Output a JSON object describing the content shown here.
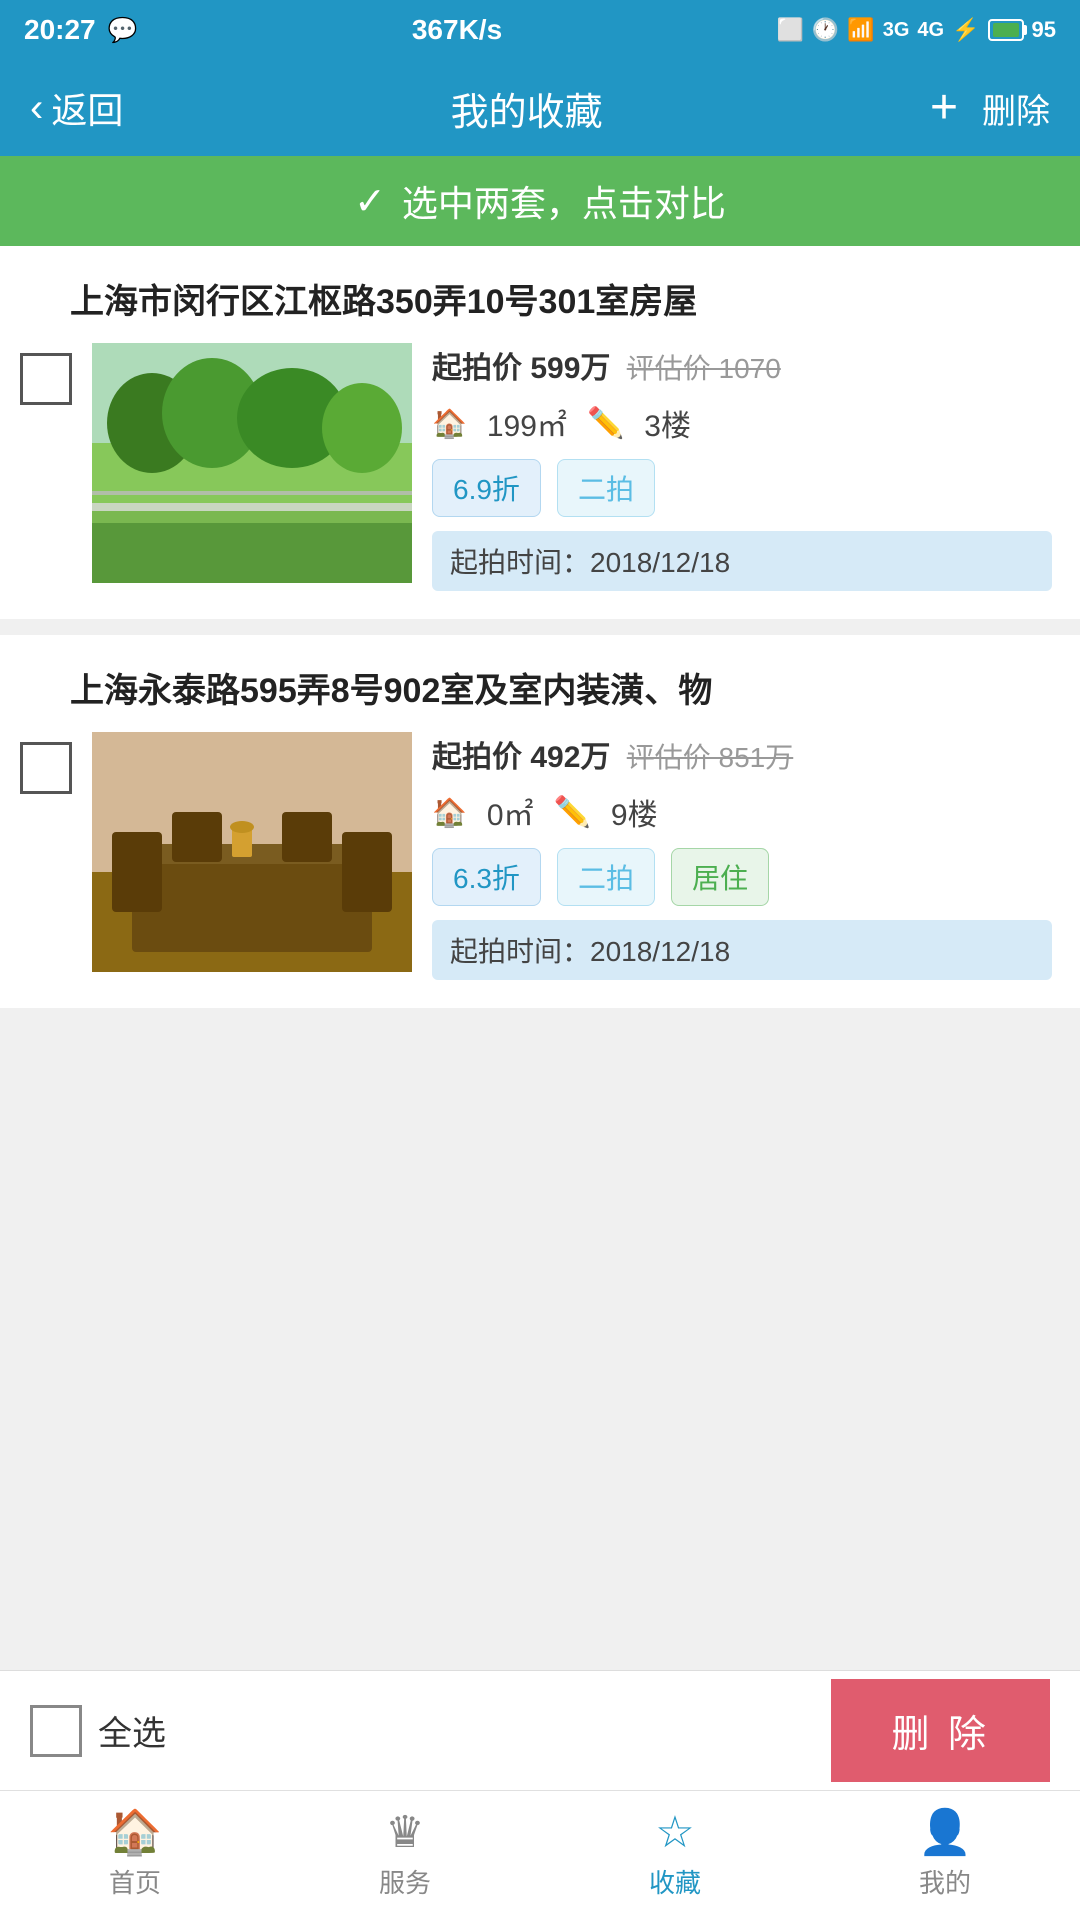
{
  "statusBar": {
    "time": "20:27",
    "network": "367K/s",
    "battery": "95"
  },
  "navBar": {
    "backLabel": "返回",
    "title": "我的收藏",
    "addLabel": "+",
    "deleteLabel": "删除"
  },
  "compareBar": {
    "checkMark": "✓",
    "label": "选中两套，点击对比"
  },
  "properties": [
    {
      "id": "prop1",
      "title": "上海市闵行区江枢路350弄10号301室房屋",
      "startPrice": "起拍价 599万",
      "estPrice": "评估价 1070",
      "area": "199㎡",
      "floor": "3楼",
      "tags": [
        "6.9折",
        "二拍"
      ],
      "startTime": "起拍时间：2018/12/18"
    },
    {
      "id": "prop2",
      "title": "上海永泰路595弄8号902室及室内装潢、物",
      "startPrice": "起拍价 492万",
      "estPrice": "评估价 851万",
      "area": "0㎡",
      "floor": "9楼",
      "tags": [
        "6.3折",
        "二拍",
        "居住"
      ],
      "startTime": "起拍时间：2018/12/18"
    }
  ],
  "actionBar": {
    "selectAllLabel": "全选",
    "deleteLabel": "删 除"
  },
  "tabBar": {
    "tabs": [
      {
        "id": "home",
        "label": "首页",
        "icon": "🏠"
      },
      {
        "id": "service",
        "label": "服务",
        "icon": "👑"
      },
      {
        "id": "favorites",
        "label": "收藏",
        "icon": "☆",
        "active": true
      },
      {
        "id": "mine",
        "label": "我的",
        "icon": "👤"
      }
    ]
  }
}
